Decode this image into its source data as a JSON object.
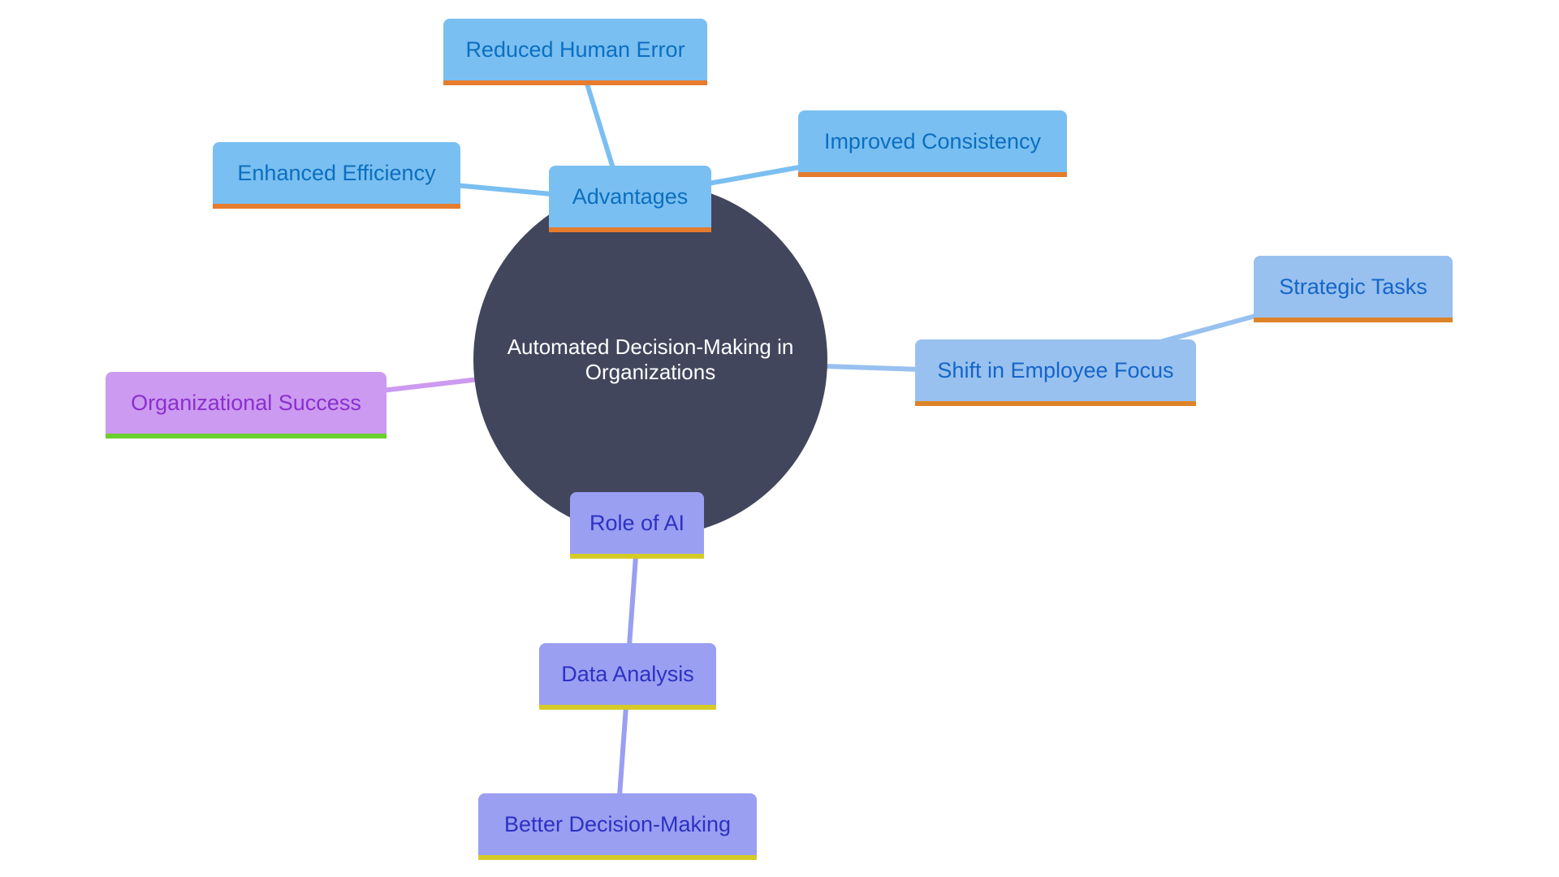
{
  "diagram": {
    "type": "mindmap",
    "root": {
      "id": "root",
      "label": "Automated Decision-Making in Organizations"
    },
    "nodes": [
      {
        "id": "advantages",
        "label": "Advantages",
        "parent": "root",
        "group": "blue"
      },
      {
        "id": "reduced_human_error",
        "label": "Reduced Human Error",
        "parent": "advantages",
        "group": "blue"
      },
      {
        "id": "improved_consistency",
        "label": "Improved Consistency",
        "parent": "advantages",
        "group": "blue"
      },
      {
        "id": "enhanced_efficiency",
        "label": "Enhanced Efficiency",
        "parent": "advantages",
        "group": "blue"
      },
      {
        "id": "shift_focus",
        "label": "Shift in Employee Focus",
        "parent": "root",
        "group": "lblue"
      },
      {
        "id": "strategic_tasks",
        "label": "Strategic Tasks",
        "parent": "shift_focus",
        "group": "lblue"
      },
      {
        "id": "org_success",
        "label": "Organizational Success",
        "parent": "root",
        "group": "purple"
      },
      {
        "id": "role_ai",
        "label": "Role of AI",
        "parent": "root",
        "group": "indigo"
      },
      {
        "id": "data_analysis",
        "label": "Data Analysis",
        "parent": "role_ai",
        "group": "indigo"
      },
      {
        "id": "better_decisions",
        "label": "Better Decision-Making",
        "parent": "data_analysis",
        "group": "indigo"
      }
    ],
    "colors": {
      "root_fill": "#42465d",
      "blue_fill": "#7abff1",
      "lblue_fill": "#98c1ef",
      "purple_fill": "#cc9af0",
      "indigo_fill": "#9a9ff2",
      "blue_edge": "#7abff1",
      "lblue_edge": "#98c1ef",
      "purple_edge": "#cc9af0",
      "indigo_edge": "#9a9ff2"
    }
  }
}
